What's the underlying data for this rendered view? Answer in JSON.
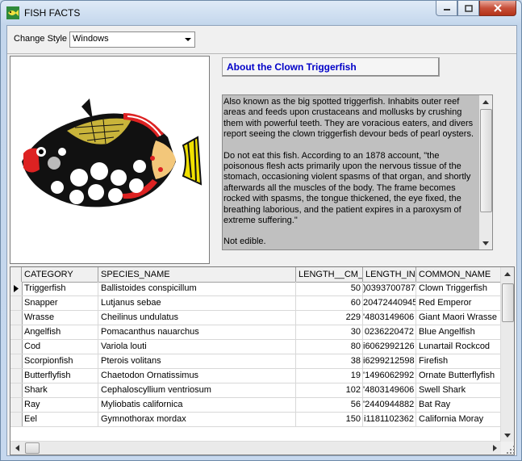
{
  "window": {
    "title": "FISH FACTS"
  },
  "style_row": {
    "label": "Change Style",
    "selected": "Windows"
  },
  "about": {
    "label": "About the  Clown Triggerfish"
  },
  "memo": {
    "paragraphs": [
      "Also known as the big spotted triggerfish.  Inhabits outer reef areas and feeds upon crustaceans and mollusks by crushing them with powerful teeth.  They are voracious eaters, and divers report seeing the clown triggerfish devour beds of pearl oysters.",
      "Do not eat this fish.  According to an 1878 account, \"the poisonous flesh acts primarily upon the nervous tissue of the stomach, occasioning violent spasms of that organ, and shortly afterwards all the muscles of the body.  The frame becomes rocked with spasms, the tongue thickened, the eye fixed, the breathing laborious, and the patient expires in a paroxysm of extreme suffering.\"",
      "Not edible."
    ]
  },
  "grid": {
    "columns": [
      "CATEGORY",
      "SPECIES_NAME",
      "LENGTH__CM_",
      "LENGTH_IN",
      "COMMON_NAME"
    ],
    "rows": [
      {
        "category": "Triggerfish",
        "species": "Ballistoides conspicillum",
        "cm": "50",
        "inches": ")0393700787",
        "common": "Clown Triggerfish"
      },
      {
        "category": "Snapper",
        "species": "Lutjanus sebae",
        "cm": "60",
        "inches": "20472440945",
        "common": "Red Emperor"
      },
      {
        "category": "Wrasse",
        "species": "Cheilinus undulatus",
        "cm": "229",
        "inches": "'4803149606",
        "common": "Giant Maori Wrasse"
      },
      {
        "category": "Angelfish",
        "species": "Pomacanthus nauarchus",
        "cm": "30",
        "inches": "0236220472",
        "common": "Blue Angelfish"
      },
      {
        "category": "Cod",
        "species": "Variola louti",
        "cm": "80",
        "inches": "i6062992126",
        "common": "Lunartail Rockcod"
      },
      {
        "category": "Scorpionfish",
        "species": "Pterois volitans",
        "cm": "38",
        "inches": "i6299212598",
        "common": "Firefish"
      },
      {
        "category": "Butterflyfish",
        "species": "Chaetodon Ornatissimus",
        "cm": "19",
        "inches": "'1496062992",
        "common": "Ornate Butterflyfish"
      },
      {
        "category": "Shark",
        "species": "Cephaloscyllium ventriosum",
        "cm": "102",
        "inches": "'4803149606",
        "common": "Swell Shark"
      },
      {
        "category": "Ray",
        "species": "Myliobatis californica",
        "cm": "56",
        "inches": "'2440944882",
        "common": "Bat Ray"
      },
      {
        "category": "Eel",
        "species": "Gymnothorax mordax",
        "cm": "150",
        "inches": "i1181102362",
        "common": "California Moray"
      }
    ]
  }
}
